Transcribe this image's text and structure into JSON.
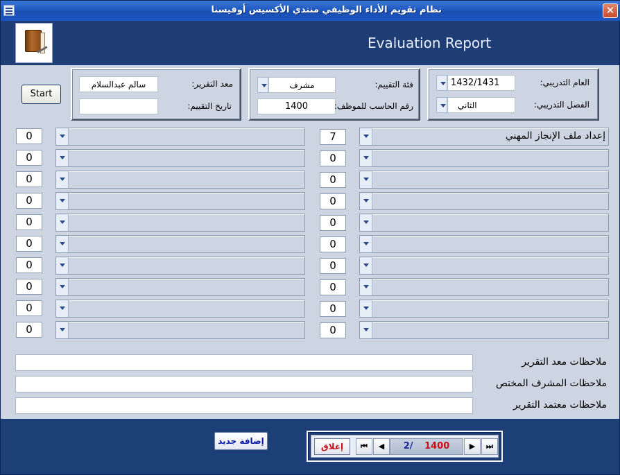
{
  "window": {
    "title": "نظام تقويم الأداء الوظيفي   منتدي الأكسيس      أوفيسنا",
    "close_glyph": "✕"
  },
  "header": {
    "report_title": "Evaluation Report",
    "icon": "book-icon"
  },
  "top_panel": {
    "start_label": "Start",
    "left_group": {
      "author_label": "معد التقرير:",
      "author_value": "سالم عبدالسلام",
      "date_label": "تاريخ التقييم:",
      "date_value": ""
    },
    "middle_group": {
      "category_label": "فئة التقييم:",
      "category_value": "مشرف",
      "employee_id_label": "رقم الحاسب للموظف:",
      "employee_id_value": "1400"
    },
    "right_group": {
      "year_label": "العام التدريبي:",
      "year_value": "1432/1431",
      "semester_label": "الفصل التدريبي:",
      "semester_value": "الثاني"
    }
  },
  "criteria_right": [
    {
      "label": "إعداد ملف الإنجاز المهني",
      "score": "7"
    },
    {
      "label": "",
      "score": "0"
    },
    {
      "label": "",
      "score": "0"
    },
    {
      "label": "",
      "score": "0"
    },
    {
      "label": "",
      "score": "0"
    },
    {
      "label": "",
      "score": "0"
    },
    {
      "label": "",
      "score": "0"
    },
    {
      "label": "",
      "score": "0"
    },
    {
      "label": "",
      "score": "0"
    },
    {
      "label": "",
      "score": "0"
    }
  ],
  "criteria_left": [
    {
      "label": "",
      "score": "0"
    },
    {
      "label": "",
      "score": "0"
    },
    {
      "label": "",
      "score": "0"
    },
    {
      "label": "",
      "score": "0"
    },
    {
      "label": "",
      "score": "0"
    },
    {
      "label": "",
      "score": "0"
    },
    {
      "label": "",
      "score": "0"
    },
    {
      "label": "",
      "score": "0"
    },
    {
      "label": "",
      "score": "0"
    },
    {
      "label": "",
      "score": "0"
    }
  ],
  "notes": {
    "author_notes_label": "ملاحظات معد التقرير",
    "supervisor_notes_label": "ملاحظات المشرف المختص",
    "approver_notes_label": "ملاحظات معتمد التقرير"
  },
  "footer": {
    "add_new_label": "إضافة جديد",
    "close_label": "إغلاق",
    "record_current": "1400",
    "record_of": "2/",
    "nav_first": "⏮",
    "nav_prev": "◀",
    "nav_next": "▶",
    "nav_last": "⏭"
  }
}
